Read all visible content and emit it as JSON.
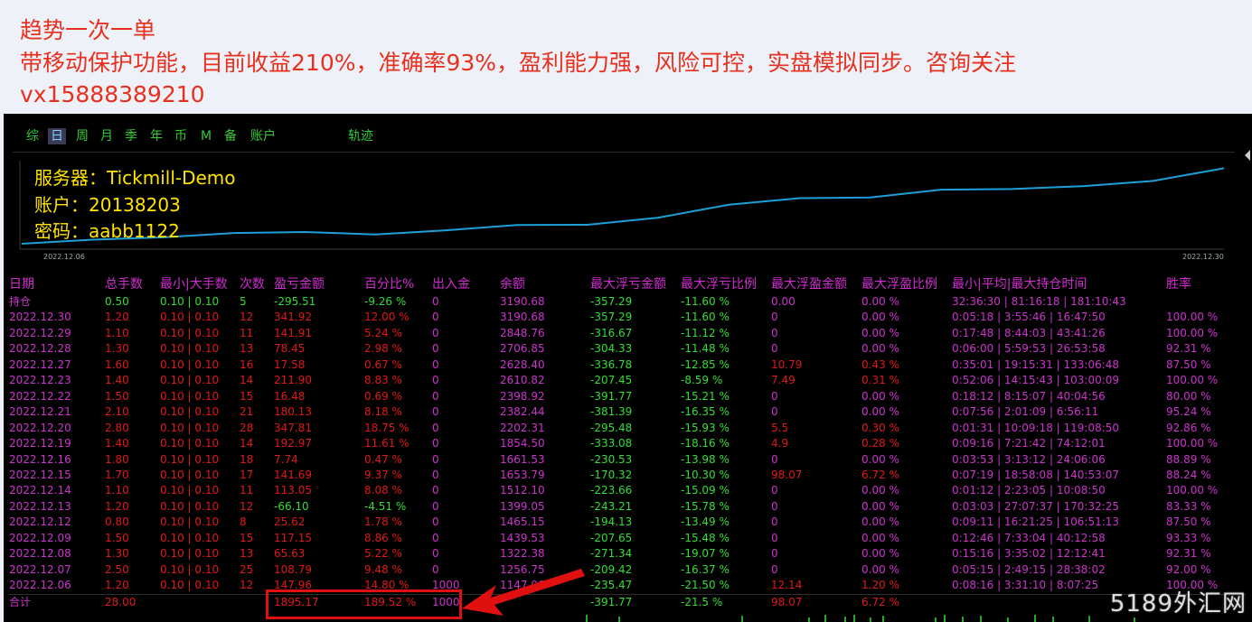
{
  "banner": {
    "line1": "趋势一次一单",
    "line2": "带移动保护功能，目前收益210%，准确率93%，盈利能力强，风险可控，实盘模拟同步。咨询关注",
    "line3": "vx15888389210"
  },
  "tabs": [
    {
      "label": "综",
      "active": false
    },
    {
      "label": "日",
      "active": true
    },
    {
      "label": "周",
      "active": false
    },
    {
      "label": "月",
      "active": false
    },
    {
      "label": "季",
      "active": false
    },
    {
      "label": "年",
      "active": false
    },
    {
      "label": "币",
      "active": false
    },
    {
      "label": "M",
      "active": false
    },
    {
      "label": "备",
      "active": false
    },
    {
      "label": "账户",
      "active": false
    },
    {
      "label": "轨迹",
      "active": false
    }
  ],
  "account": {
    "server": "服务器：Tickmill-Demo",
    "account": "账户：20138203",
    "password": "密码：aabb1122"
  },
  "equity_chart": {
    "start_label": "2022.12.06",
    "end_label": "2022.12.30",
    "line_color": "#1e9fd8",
    "balance_points": [
      1147.96,
      1256.75,
      1322.38,
      1439.53,
      1465.15,
      1399.05,
      1512.1,
      1653.79,
      1661.53,
      1854.5,
      2202.31,
      2382.44,
      2398.92,
      2610.82,
      2628.4,
      2706.85,
      2848.76,
      3190.68
    ]
  },
  "table": {
    "headers": [
      "日期",
      "总手数",
      "最小|大手数",
      "次数",
      "盈亏金额",
      "百分比%",
      "出入金",
      "余额",
      "最大浮亏金额",
      "最大浮亏比例",
      "最大浮盈金额",
      "最大浮盈比例",
      "最小|平均|最大持仓时间",
      "胜率"
    ],
    "holding": {
      "date": "持仓",
      "lots": "0.50",
      "minmax": "0.10 | 0.10",
      "count": "5",
      "pnl": "-295.51",
      "pct": "-9.26 %",
      "inout": "0",
      "balance": "3190.68",
      "maxfl": "-357.29",
      "maxflp": "-11.60 %",
      "maxfp": "0.00",
      "maxfpp": "0.00 %",
      "time": "32:36:30 | 81:16:18 | 181:10:43",
      "win": ""
    },
    "rows": [
      {
        "date": "2022.12.30",
        "lots": "1.20",
        "minmax": "0.10 | 0.10",
        "count": "12",
        "pnl": "341.92",
        "pct": "12.00 %",
        "inout": "0",
        "balance": "3190.68",
        "maxfl": "-357.29",
        "maxflp": "-11.60 %",
        "maxfp": "0",
        "maxfpp": "0.00 %",
        "time": "0:05:18 | 3:55:46 | 16:47:50",
        "win": "100.00 %"
      },
      {
        "date": "2022.12.29",
        "lots": "1.10",
        "minmax": "0.10 | 0.10",
        "count": "11",
        "pnl": "141.91",
        "pct": "5.24 %",
        "inout": "0",
        "balance": "2848.76",
        "maxfl": "-316.67",
        "maxflp": "-11.12 %",
        "maxfp": "0",
        "maxfpp": "0.00 %",
        "time": "0:17:48 | 8:44:03 | 43:41:26",
        "win": "100.00 %"
      },
      {
        "date": "2022.12.28",
        "lots": "1.30",
        "minmax": "0.10 | 0.10",
        "count": "13",
        "pnl": "78.45",
        "pct": "2.98 %",
        "inout": "0",
        "balance": "2706.85",
        "maxfl": "-304.33",
        "maxflp": "-11.48 %",
        "maxfp": "0",
        "maxfpp": "0.00 %",
        "time": "0:06:00 | 5:59:53 | 26:53:58",
        "win": "92.31 %"
      },
      {
        "date": "2022.12.27",
        "lots": "1.60",
        "minmax": "0.10 | 0.10",
        "count": "16",
        "pnl": "17.58",
        "pct": "0.67 %",
        "inout": "0",
        "balance": "2628.40",
        "maxfl": "-336.78",
        "maxflp": "-12.85 %",
        "maxfp": "10.79",
        "maxfpp": "0.43 %",
        "time": "0:35:01 | 19:15:31 | 133:06:48",
        "win": "87.50 %"
      },
      {
        "date": "2022.12.23",
        "lots": "1.40",
        "minmax": "0.10 | 0.10",
        "count": "14",
        "pnl": "211.90",
        "pct": "8.83 %",
        "inout": "0",
        "balance": "2610.82",
        "maxfl": "-207.45",
        "maxflp": "-8.59 %",
        "maxfp": "7.49",
        "maxfpp": "0.31 %",
        "time": "0:52:06 | 14:15:43 | 103:00:09",
        "win": "100.00 %"
      },
      {
        "date": "2022.12.22",
        "lots": "1.50",
        "minmax": "0.10 | 0.10",
        "count": "15",
        "pnl": "16.48",
        "pct": "0.69 %",
        "inout": "0",
        "balance": "2398.92",
        "maxfl": "-391.77",
        "maxflp": "-15.21 %",
        "maxfp": "0",
        "maxfpp": "0.00 %",
        "time": "0:18:12 | 8:15:07 | 40:04:56",
        "win": "80.00 %"
      },
      {
        "date": "2022.12.21",
        "lots": "2.10",
        "minmax": "0.10 | 0.10",
        "count": "21",
        "pnl": "180.13",
        "pct": "8.18 %",
        "inout": "0",
        "balance": "2382.44",
        "maxfl": "-381.39",
        "maxflp": "-16.35 %",
        "maxfp": "0",
        "maxfpp": "0.00 %",
        "time": "0:07:56 | 2:01:09 | 6:56:11",
        "win": "95.24 %"
      },
      {
        "date": "2022.12.20",
        "lots": "2.80",
        "minmax": "0.10 | 0.10",
        "count": "28",
        "pnl": "347.81",
        "pct": "18.75 %",
        "inout": "0",
        "balance": "2202.31",
        "maxfl": "-295.48",
        "maxflp": "-15.93 %",
        "maxfp": "5.5",
        "maxfpp": "0.30 %",
        "time": "0:01:31 | 10:09:18 | 119:08:50",
        "win": "92.86 %"
      },
      {
        "date": "2022.12.19",
        "lots": "1.40",
        "minmax": "0.10 | 0.10",
        "count": "14",
        "pnl": "192.97",
        "pct": "11.61 %",
        "inout": "0",
        "balance": "1854.50",
        "maxfl": "-333.08",
        "maxflp": "-18.16 %",
        "maxfp": "4.9",
        "maxfpp": "0.28 %",
        "time": "0:09:16 | 7:21:42 | 74:12:01",
        "win": "100.00 %"
      },
      {
        "date": "2022.12.16",
        "lots": "1.80",
        "minmax": "0.10 | 0.10",
        "count": "18",
        "pnl": "7.74",
        "pct": "0.47 %",
        "inout": "0",
        "balance": "1661.53",
        "maxfl": "-230.53",
        "maxflp": "-13.98 %",
        "maxfp": "0",
        "maxfpp": "0.00 %",
        "time": "0:03:53 | 3:13:12 | 24:06:06",
        "win": "88.89 %"
      },
      {
        "date": "2022.12.15",
        "lots": "1.70",
        "minmax": "0.10 | 0.10",
        "count": "17",
        "pnl": "141.69",
        "pct": "9.37 %",
        "inout": "0",
        "balance": "1653.79",
        "maxfl": "-170.32",
        "maxflp": "-10.30 %",
        "maxfp": "98.07",
        "maxfpp": "6.72 %",
        "time": "0:07:19 | 18:58:08 | 140:53:07",
        "win": "88.24 %"
      },
      {
        "date": "2022.12.14",
        "lots": "1.10",
        "minmax": "0.10 | 0.10",
        "count": "11",
        "pnl": "113.05",
        "pct": "8.08 %",
        "inout": "0",
        "balance": "1512.10",
        "maxfl": "-223.66",
        "maxflp": "-15.09 %",
        "maxfp": "0",
        "maxfpp": "0.00 %",
        "time": "0:01:12 | 2:23:05 | 10:08:50",
        "win": "100.00 %"
      },
      {
        "date": "2022.12.13",
        "lots": "1.20",
        "minmax": "0.10 | 0.10",
        "count": "12",
        "pnl": "-66.10",
        "pct": "-4.51 %",
        "inout": "0",
        "balance": "1399.05",
        "maxfl": "-243.21",
        "maxflp": "-15.78 %",
        "maxfp": "0",
        "maxfpp": "0.00 %",
        "time": "0:03:03 | 27:07:37 | 170:32:25",
        "win": "83.33 %"
      },
      {
        "date": "2022.12.12",
        "lots": "0.80",
        "minmax": "0.10 | 0.10",
        "count": "8",
        "pnl": "25.62",
        "pct": "1.78 %",
        "inout": "0",
        "balance": "1465.15",
        "maxfl": "-194.13",
        "maxflp": "-13.49 %",
        "maxfp": "0",
        "maxfpp": "0.00 %",
        "time": "0:09:11 | 16:21:25 | 106:51:13",
        "win": "87.50 %"
      },
      {
        "date": "2022.12.09",
        "lots": "1.50",
        "minmax": "0.10 | 0.10",
        "count": "15",
        "pnl": "117.15",
        "pct": "8.86 %",
        "inout": "0",
        "balance": "1439.53",
        "maxfl": "-207.65",
        "maxflp": "-15.48 %",
        "maxfp": "0",
        "maxfpp": "0.00 %",
        "time": "0:12:46 | 7:33:04 | 40:12:58",
        "win": "93.33 %"
      },
      {
        "date": "2022.12.08",
        "lots": "1.30",
        "minmax": "0.10 | 0.10",
        "count": "13",
        "pnl": "65.63",
        "pct": "5.22 %",
        "inout": "0",
        "balance": "1322.38",
        "maxfl": "-271.34",
        "maxflp": "-19.07 %",
        "maxfp": "0",
        "maxfpp": "0.00 %",
        "time": "0:15:16 | 3:35:02 | 12:12:41",
        "win": "92.31 %"
      },
      {
        "date": "2022.12.07",
        "lots": "2.50",
        "minmax": "0.10 | 0.10",
        "count": "25",
        "pnl": "108.79",
        "pct": "9.48 %",
        "inout": "0",
        "balance": "1256.75",
        "maxfl": "-209.42",
        "maxflp": "-16.37 %",
        "maxfp": "0",
        "maxfpp": "0.00 %",
        "time": "0:05:15 | 2:49:15 | 28:38:02",
        "win": "92.00 %"
      },
      {
        "date": "2022.12.06",
        "lots": "1.20",
        "minmax": "0.10 | 0.10",
        "count": "12",
        "pnl": "147.96",
        "pct": "14.80 %",
        "inout": "1000",
        "balance": "1147.96",
        "maxfl": "-235.47",
        "maxflp": "-21.50 %",
        "maxfp": "12.14",
        "maxfpp": "1.20 %",
        "time": "0:08:16 | 3:31:10 | 8:07:25",
        "win": "100.00 %"
      }
    ],
    "total": {
      "date": "合计",
      "lots": "28.00",
      "minmax": "",
      "count": "",
      "pnl": "1895.17",
      "pct": "189.52 %",
      "inout": "1000",
      "balance": "",
      "maxfl": "-391.77",
      "maxflp": "-21.5 %",
      "maxfp": "98.07",
      "maxfpp": "6.72 %",
      "time": "",
      "win": ""
    }
  },
  "watermark": "5189外汇网"
}
